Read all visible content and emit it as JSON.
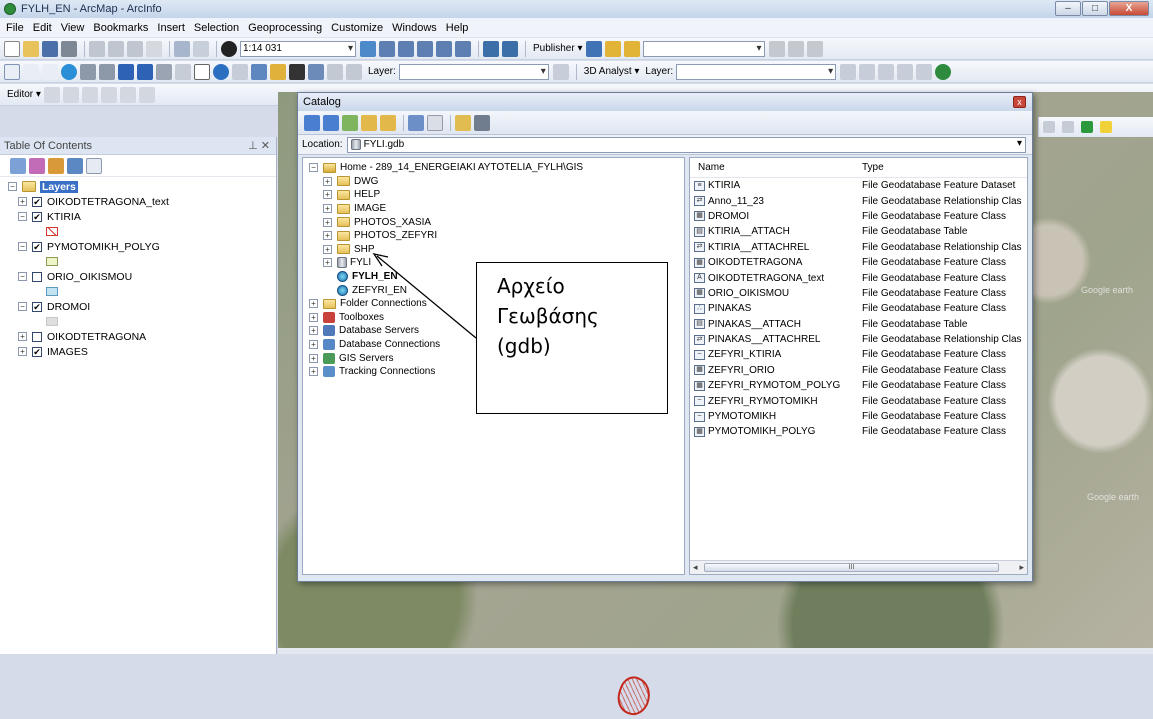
{
  "window": {
    "title": "FYLH_EN - ArcMap - ArcInfo",
    "min": "–",
    "max": "□",
    "close": "X"
  },
  "menubar": [
    "File",
    "Edit",
    "View",
    "Bookmarks",
    "Insert",
    "Selection",
    "Geoprocessing",
    "Customize",
    "Windows",
    "Help"
  ],
  "toolbar1": {
    "scale": "1:14 031",
    "publisher": "Publisher ▾"
  },
  "toolbar2": {
    "layer_label": "Layer:",
    "analyst": "3D Analyst ▾",
    "layer_label2": "Layer:"
  },
  "toolbar3": {
    "editor": "Editor ▾"
  },
  "toc": {
    "title": "Table Of Contents",
    "header_buttons": "⊥ ✕",
    "layers_root": "Layers",
    "layers": [
      {
        "name": "OIKODTETRAGONA_text",
        "checked": "✔",
        "expander": "+"
      },
      {
        "name": "KTIRIA",
        "checked": "✔",
        "expander": "−"
      },
      {
        "name": "PYMOTOMIKH_POLYG",
        "checked": "✔",
        "expander": "−"
      },
      {
        "name": "ORIO_OIKISMOU",
        "checked": "",
        "expander": "−"
      },
      {
        "name": "DROMOI",
        "checked": "✔",
        "expander": "−"
      },
      {
        "name": "OIKODTETRAGONA",
        "checked": "",
        "expander": "+"
      },
      {
        "name": "IMAGES",
        "checked": "✔",
        "expander": "+"
      }
    ]
  },
  "catalog": {
    "title": "Catalog",
    "close": "x",
    "location_label": "Location:",
    "location_value": "FYLI.gdb",
    "tree": {
      "home": "Home - 289_14_ENERGEIAKI AYTOTELIA_FYLH\\GIS",
      "folders": [
        "DWG",
        "HELP",
        "IMAGE",
        "PHOTOS_XASIA",
        "PHOTOS_ZEFYRI",
        "SHP"
      ],
      "gdb": "FYLI",
      "maps": [
        "FYLH_EN",
        "ZEFYRI_EN"
      ],
      "roots": [
        "Folder Connections",
        "Toolboxes",
        "Database Servers",
        "Database Connections",
        "GIS Servers",
        "Tracking Connections"
      ]
    },
    "list": {
      "col_name": "Name",
      "col_type": "Type",
      "rows": [
        {
          "icon": "≡",
          "name": "KTIRIA",
          "type": "File Geodatabase Feature Dataset"
        },
        {
          "icon": "⇄",
          "name": "Anno_11_23",
          "type": "File Geodatabase Relationship Clas"
        },
        {
          "icon": "▦",
          "name": "DROMOI",
          "type": "File Geodatabase Feature Class"
        },
        {
          "icon": "▤",
          "name": "KTIRIA__ATTACH",
          "type": "File Geodatabase Table"
        },
        {
          "icon": "⇄",
          "name": "KTIRIA__ATTACHREL",
          "type": "File Geodatabase Relationship Clas"
        },
        {
          "icon": "▦",
          "name": "OIKODTETRAGONA",
          "type": "File Geodatabase Feature Class"
        },
        {
          "icon": "A",
          "name": "OIKODTETRAGONA_text",
          "type": "File Geodatabase Feature Class"
        },
        {
          "icon": "▦",
          "name": "ORIO_OIKISMOU",
          "type": "File Geodatabase Feature Class"
        },
        {
          "icon": "∴",
          "name": "PINAKAS",
          "type": "File Geodatabase Feature Class"
        },
        {
          "icon": "▤",
          "name": "PINAKAS__ATTACH",
          "type": "File Geodatabase Table"
        },
        {
          "icon": "⇄",
          "name": "PINAKAS__ATTACHREL",
          "type": "File Geodatabase Relationship Clas"
        },
        {
          "icon": "~",
          "name": "ZEFYRI_KTIRIA",
          "type": "File Geodatabase Feature Class"
        },
        {
          "icon": "▦",
          "name": "ZEFYRI_ORIO",
          "type": "File Geodatabase Feature Class"
        },
        {
          "icon": "▦",
          "name": "ZEFYRI_RYMOTOM_POLYG",
          "type": "File Geodatabase Feature Class"
        },
        {
          "icon": "~",
          "name": "ZEFYRI_RYMOTOMIKH",
          "type": "File Geodatabase Feature Class"
        },
        {
          "icon": "~",
          "name": "PYMOTOMIKH",
          "type": "File Geodatabase Feature Class"
        },
        {
          "icon": "▦",
          "name": "PYMOTOMIKH_POLYG",
          "type": "File Geodatabase Feature Class"
        }
      ],
      "scroll_thumb": "III"
    }
  },
  "annotation": {
    "lines": [
      "Αρχείο",
      "Γεωβάσης",
      "(gdb)"
    ]
  },
  "map": {
    "watermark": "Google earth"
  },
  "colors": {
    "accent": "#3a6fc6",
    "highlight_red": "#c3271b"
  }
}
